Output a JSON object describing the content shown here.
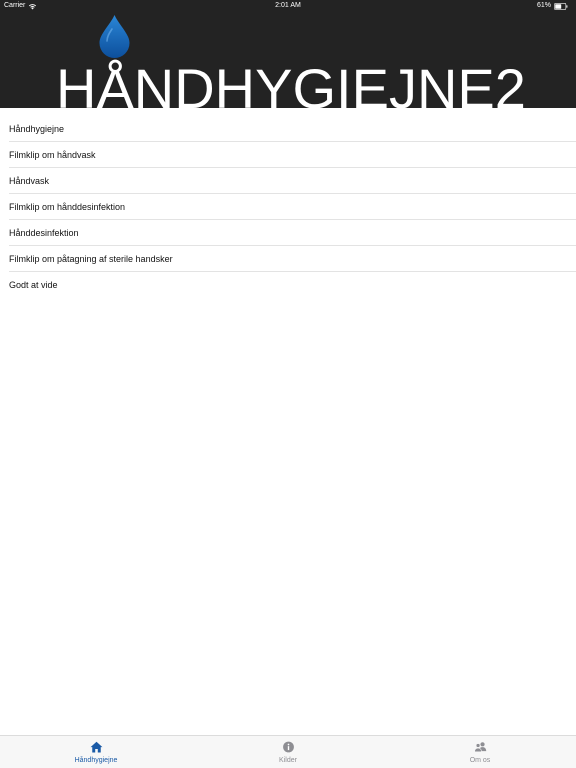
{
  "status_bar": {
    "carrier": "Carrier",
    "time": "2:01 AM",
    "battery": "61%"
  },
  "banner": {
    "title": "HÅNDHYGIEJNE2"
  },
  "list": {
    "items": [
      {
        "label": "Håndhygiejne"
      },
      {
        "label": "Filmklip om håndvask"
      },
      {
        "label": "Håndvask"
      },
      {
        "label": "Filmklip om hånddesinfektion"
      },
      {
        "label": "Hånddesinfektion"
      },
      {
        "label": "Filmklip om påtagning af sterile handsker"
      },
      {
        "label": "Godt at vide"
      }
    ]
  },
  "tab_bar": {
    "tabs": [
      {
        "label": "Håndhygiejne",
        "icon": "home-icon",
        "active": true
      },
      {
        "label": "Kilder",
        "icon": "info-icon",
        "active": false
      },
      {
        "label": "Om os",
        "icon": "people-icon",
        "active": false
      }
    ]
  },
  "colors": {
    "header_bg": "#232323",
    "active_tab": "#1a5aa6",
    "inactive_tab": "#8e8e93",
    "drop_blue": "#1f6fc4"
  }
}
